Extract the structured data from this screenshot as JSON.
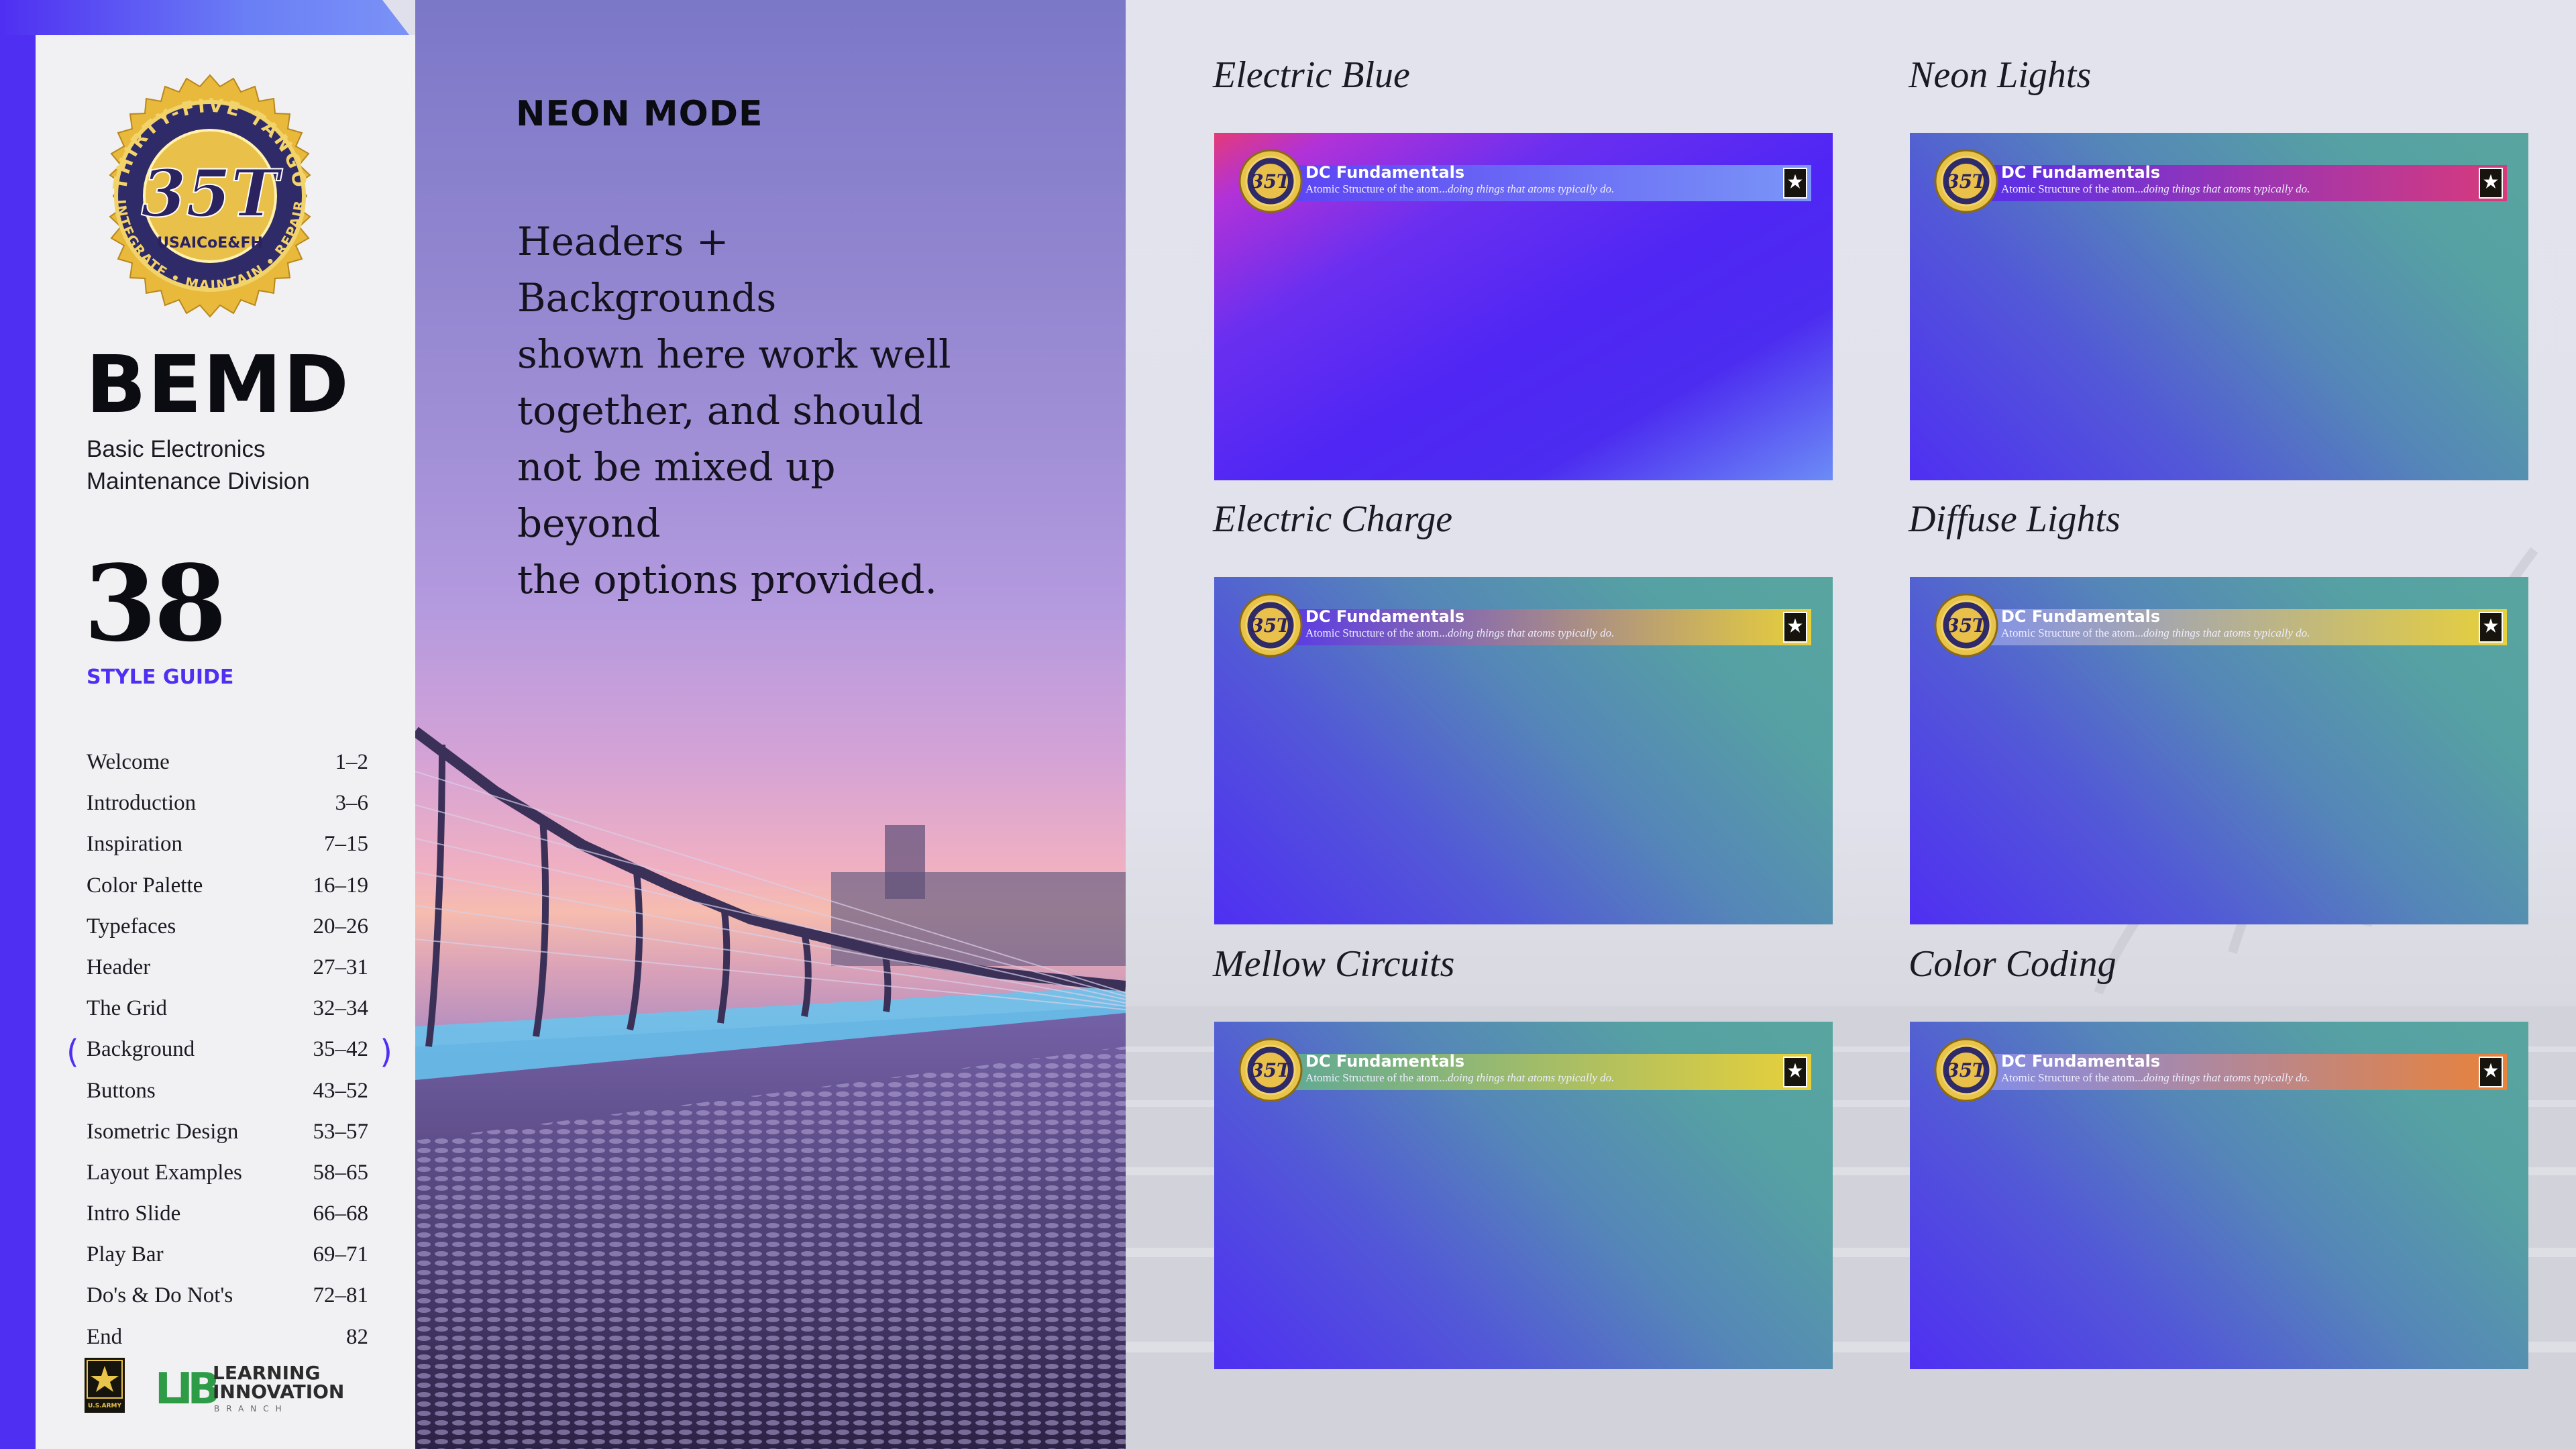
{
  "sidebar": {
    "badge": {
      "arc_top": "THIRTY-FIVE TANGO",
      "arc_bottom": "INTEGRATE • MAINTAIN • REPAIR",
      "center": "35T",
      "inner": "USAICoE&FH"
    },
    "title": "BEMD",
    "subtitle_line1": "Basic Electronics",
    "subtitle_line2": "Maintenance Division",
    "number": "38",
    "style_guide": "STYLE GUIDE",
    "toc": [
      {
        "label": "Welcome",
        "pages": "1–2"
      },
      {
        "label": "Introduction",
        "pages": "3–6"
      },
      {
        "label": "Inspiration",
        "pages": "7–15"
      },
      {
        "label": "Color Palette",
        "pages": "16–19"
      },
      {
        "label": "Typefaces",
        "pages": "20–26"
      },
      {
        "label": "Header",
        "pages": "27–31"
      },
      {
        "label": "The Grid",
        "pages": "32–34"
      },
      {
        "label": "Background",
        "pages": "35–42"
      },
      {
        "label": "Buttons",
        "pages": "43–52"
      },
      {
        "label": "Isometric Design",
        "pages": "53–57"
      },
      {
        "label": "Layout Examples",
        "pages": "58–65"
      },
      {
        "label": "Intro Slide",
        "pages": "66–68"
      },
      {
        "label": "Play Bar",
        "pages": "69–71"
      },
      {
        "label": "Do's & Do Not's",
        "pages": "72–81"
      },
      {
        "label": "End",
        "pages": "82"
      }
    ],
    "active_index": 7,
    "army_text": "U.S.ARMY",
    "lib": {
      "mark": "LIB",
      "line1": "LEARNING",
      "line2": "INNOVATION",
      "line3": "BRANCH"
    }
  },
  "middle": {
    "heading": "NEON MODE",
    "body_lines": [
      "Headers + Backgrounds",
      "shown here work well",
      "together, and should",
      "not be mixed up beyond",
      "the options provided."
    ]
  },
  "samples": {
    "header_title": "DC Fundamentals",
    "header_sub_plain": "Atomic Structure of the atom...",
    "header_sub_italic": "doing things that atoms typically do.",
    "seal_text": "35T",
    "items": [
      {
        "name": "Electric Blue",
        "bar_from": "#5a3ef3",
        "bar_to": "#7a95f7",
        "bg": "electric-blue",
        "star_color": "#ffffff"
      },
      {
        "name": "Neon Lights",
        "bar_from": "#4f2ff2",
        "bar_to": "#d83a7c",
        "bg": "teal",
        "star_color": "#ffffff"
      },
      {
        "name": "Electric Charge",
        "bar_from": "#4f2ff2",
        "bar_to": "#e8d03a",
        "bg": "teal",
        "star_color": "#ffffff"
      },
      {
        "name": "Diffuse Lights",
        "bar_from": "#7c8df5",
        "bar_to": "#e8d03a",
        "bg": "teal",
        "star_color": "#ffffff"
      },
      {
        "name": "Mellow Circuits",
        "bar_from": "#56a79b",
        "bar_to": "#e8d03a",
        "bg": "teal",
        "star_color": "#ffffff"
      },
      {
        "name": "Color Coding",
        "bar_from": "#7c8df5",
        "bar_to": "#e9823a",
        "bg": "teal",
        "star_color": "#ffffff"
      }
    ]
  },
  "colors": {
    "accent": "#4f2ff2",
    "teal": "#56a79b",
    "gold": "#e8c44a",
    "ink": "#0b0b12"
  }
}
